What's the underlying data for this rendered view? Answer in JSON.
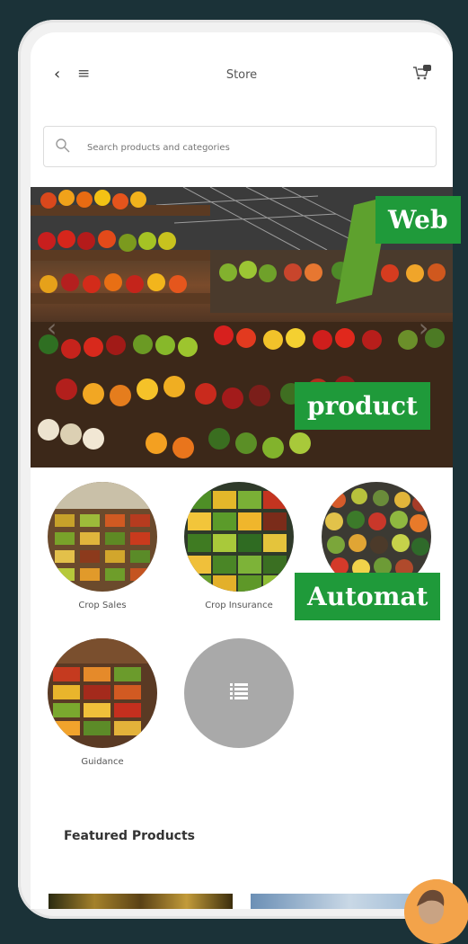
{
  "topbar": {
    "title": "Store"
  },
  "search": {
    "placeholder": "Search products and categories"
  },
  "banner": {
    "overlays": [
      "Web",
      "product",
      "Automat"
    ]
  },
  "categories": [
    {
      "label": "Crop Sales"
    },
    {
      "label": "Crop Insurance"
    },
    {
      "label": ""
    },
    {
      "label": "Guidance"
    },
    {
      "label": ""
    }
  ],
  "featured": {
    "title": "Featured Products"
  },
  "colors": {
    "accent": "#1f9a3a",
    "background": "#1b3238",
    "more_button": "#a9a9a9"
  },
  "icons": {
    "back": "back-icon",
    "menu": "menu-icon",
    "cart": "cart-icon",
    "search": "search-icon",
    "list": "list-icon"
  }
}
